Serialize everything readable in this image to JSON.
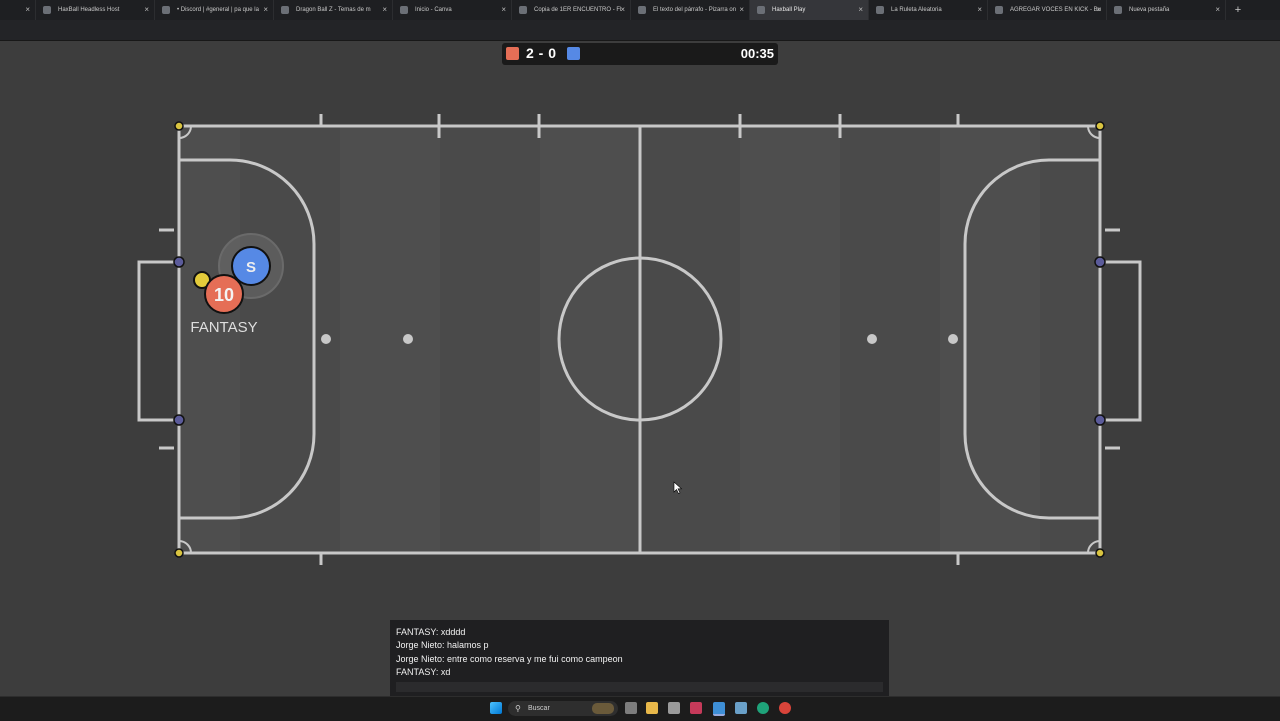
{
  "browser": {
    "tabs": [
      {
        "title": "",
        "active": false
      },
      {
        "title": "HaxBall Headless Host",
        "active": false
      },
      {
        "title": "• Discord | #general | pa que la",
        "active": false
      },
      {
        "title": "Dragon Ball Z - Temas de m",
        "active": false
      },
      {
        "title": "Inicio - Canva",
        "active": false
      },
      {
        "title": "Copia de 1ER ENCUENTRO - Fl",
        "active": false
      },
      {
        "title": "El texto del párrafo - Pizarra on",
        "active": false
      },
      {
        "title": "Haxball Play",
        "active": true
      },
      {
        "title": "La Ruleta Aleatoria",
        "active": false
      },
      {
        "title": "AGREGAR VOCES EN KICK - Bu",
        "active": false
      },
      {
        "title": "Nueva pestaña",
        "active": false
      }
    ],
    "new_tab_label": "+",
    "close_glyph": "×"
  },
  "scoreboard": {
    "red_score": 2,
    "separator": "-",
    "blue_score": 0,
    "score_text": "2 - 0",
    "timer": "00:35",
    "red_color": "#e56e56",
    "blue_color": "#5689e5"
  },
  "players": [
    {
      "team": "blue",
      "avatar": "S",
      "name": ""
    },
    {
      "team": "red",
      "avatar": "10",
      "name": "FANTASY"
    }
  ],
  "chat": {
    "messages": [
      "FANTASY: xdddd",
      "Jorge Nieto: halamos p",
      "Jorge Nieto: entre como reserva y me fui como campeon",
      "FANTASY: xd"
    ],
    "input_value": ""
  },
  "taskbar": {
    "search_label": "Buscar",
    "icons": [
      "windows-icon",
      "search-icon",
      "task-view-icon",
      "file-explorer-icon",
      "app-icon",
      "tiktok-icon",
      "browser-icon",
      "notepad-icon",
      "edge-icon",
      "chrome-icon"
    ]
  },
  "colors": {
    "pitch": "#4f4f4f",
    "lines": "#c7c7c7",
    "goal_post": "#5a5a8a",
    "corner_post": "#d8c040",
    "red_team": "#e56e56",
    "blue_team": "#5689e5"
  }
}
